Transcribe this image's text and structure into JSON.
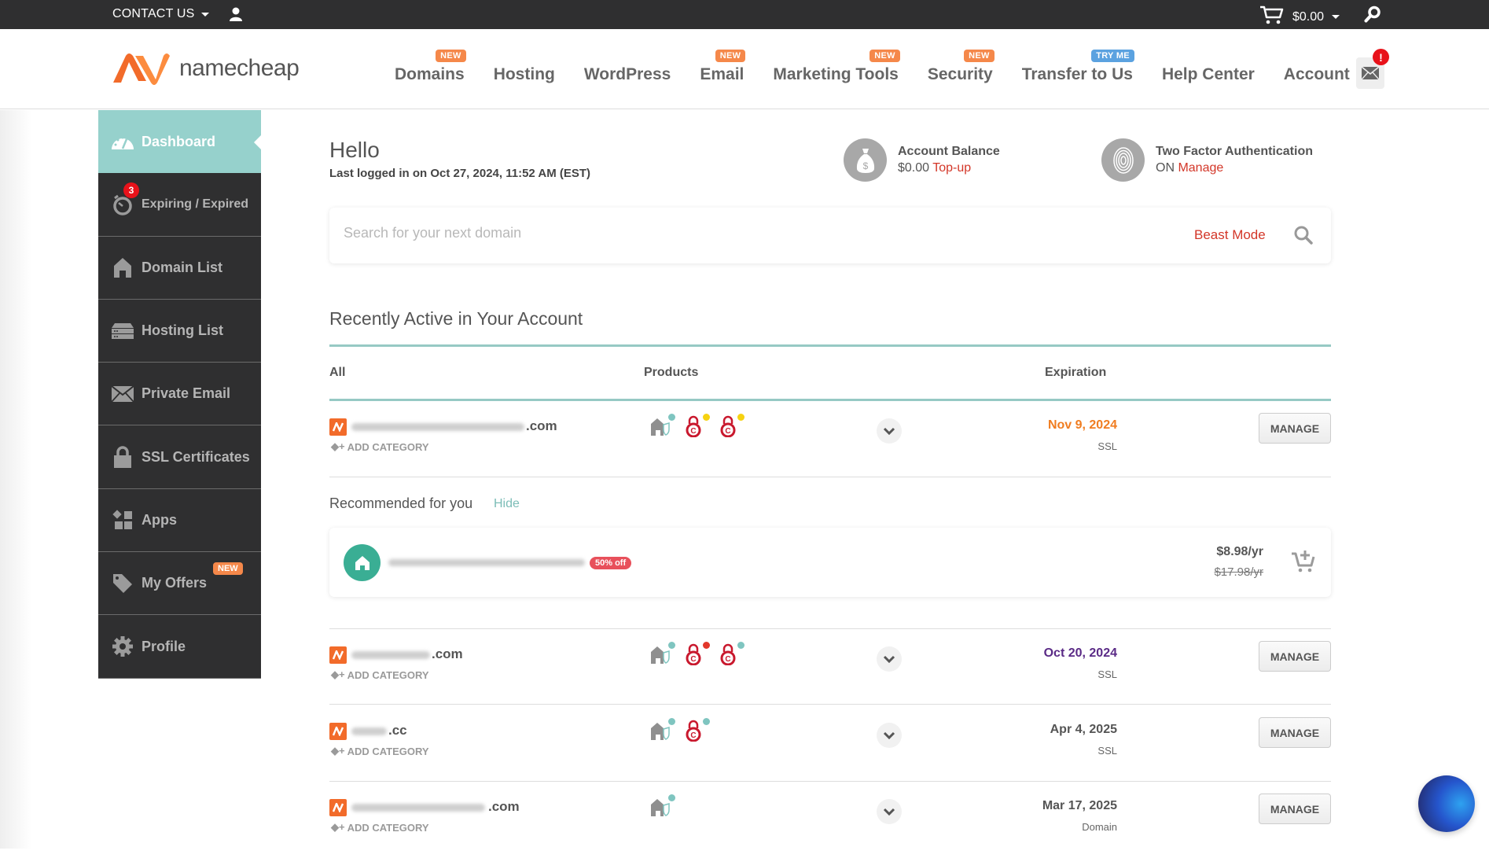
{
  "topbar": {
    "contact_label": "CONTACT US",
    "cart_amount": "$0.00"
  },
  "header": {
    "logo_text": "namecheap",
    "nav": [
      {
        "label": "Domains",
        "badge": "NEW"
      },
      {
        "label": "Hosting",
        "badge": ""
      },
      {
        "label": "WordPress",
        "badge": ""
      },
      {
        "label": "Email",
        "badge": "NEW"
      },
      {
        "label": "Marketing Tools",
        "badge": "NEW"
      },
      {
        "label": "Security",
        "badge": "NEW"
      },
      {
        "label": "Transfer to Us",
        "badge": "TRY ME"
      },
      {
        "label": "Help Center",
        "badge": ""
      },
      {
        "label": "Account",
        "badge": ""
      }
    ],
    "mail_alert": "!"
  },
  "sidebar": {
    "items": [
      {
        "label": "Dashboard",
        "icon": "dashboard-gauge-icon",
        "active": true
      },
      {
        "label": "Expiring / Expired",
        "icon": "stopwatch-icon",
        "count": "3"
      },
      {
        "label": "Domain List",
        "icon": "house-icon"
      },
      {
        "label": "Hosting List",
        "icon": "server-icon"
      },
      {
        "label": "Private Email",
        "icon": "envelope-icon"
      },
      {
        "label": "SSL Certificates",
        "icon": "lock-icon"
      },
      {
        "label": "Apps",
        "icon": "apps-grid-icon"
      },
      {
        "label": "My Offers",
        "icon": "tag-icon",
        "badge": "NEW"
      },
      {
        "label": "Profile",
        "icon": "gear-icon"
      }
    ]
  },
  "main": {
    "greeting": "Hello",
    "last_login": "Last logged in on Oct 27, 2024, 11:52 AM (EST)",
    "account_balance": {
      "title": "Account Balance",
      "value": "$0.00",
      "link": "Top-up"
    },
    "two_factor": {
      "title": "Two Factor Authentication",
      "value": "ON",
      "link": "Manage"
    },
    "search": {
      "placeholder": "Search for your next domain",
      "value": "",
      "beast_mode": "Beast Mode"
    },
    "recent_title": "Recently Active in Your Account",
    "columns": {
      "all": "All",
      "products": "Products",
      "expiration": "Expiration"
    },
    "add_category": "ADD CATEGORY",
    "manage_label": "MANAGE",
    "rows": [
      {
        "tld": ".com",
        "expiration": "Nov 9, 2024",
        "exp_color": "#f07d21",
        "type": "SSL",
        "products": [
          {
            "icon": "hosting-shield-icon",
            "dot": "#7fc5c0"
          },
          {
            "icon": "ssl-lock-icon",
            "dot": "#f6d211"
          },
          {
            "icon": "ssl-lock-icon",
            "dot": "#f6d211"
          }
        ]
      },
      {
        "tld": ".com",
        "expiration": "Oct 20, 2024",
        "exp_color": "#5a2a86",
        "type": "SSL",
        "products": [
          {
            "icon": "hosting-shield-icon",
            "dot": "#7fc5c0"
          },
          {
            "icon": "ssl-lock-icon",
            "dot": "#e2372b"
          },
          {
            "icon": "ssl-lock-icon",
            "dot": "#7fc5c0"
          }
        ]
      },
      {
        "tld": ".cc",
        "expiration": "Apr 4, 2025",
        "exp_color": "#555555",
        "type": "SSL",
        "products": [
          {
            "icon": "hosting-shield-icon",
            "dot": "#7fc5c0"
          },
          {
            "icon": "ssl-lock-icon",
            "dot": "#7fc5c0"
          }
        ]
      },
      {
        "tld": ".com",
        "expiration": "Mar 17, 2025",
        "exp_color": "#555555",
        "type": "Domain",
        "products": [
          {
            "icon": "hosting-shield-icon",
            "dot": "#7fc5c0"
          }
        ]
      }
    ],
    "recommended": {
      "title": "Recommended for you",
      "hide": "Hide",
      "discount": "50% off",
      "price": "$8.98/yr",
      "old_price": "$17.98/yr"
    }
  },
  "colors": {
    "accent_teal": "#96d1cc",
    "brand_orange": "#f26b2a",
    "link_red": "#d33628",
    "dark_bg": "#2f2f30"
  }
}
